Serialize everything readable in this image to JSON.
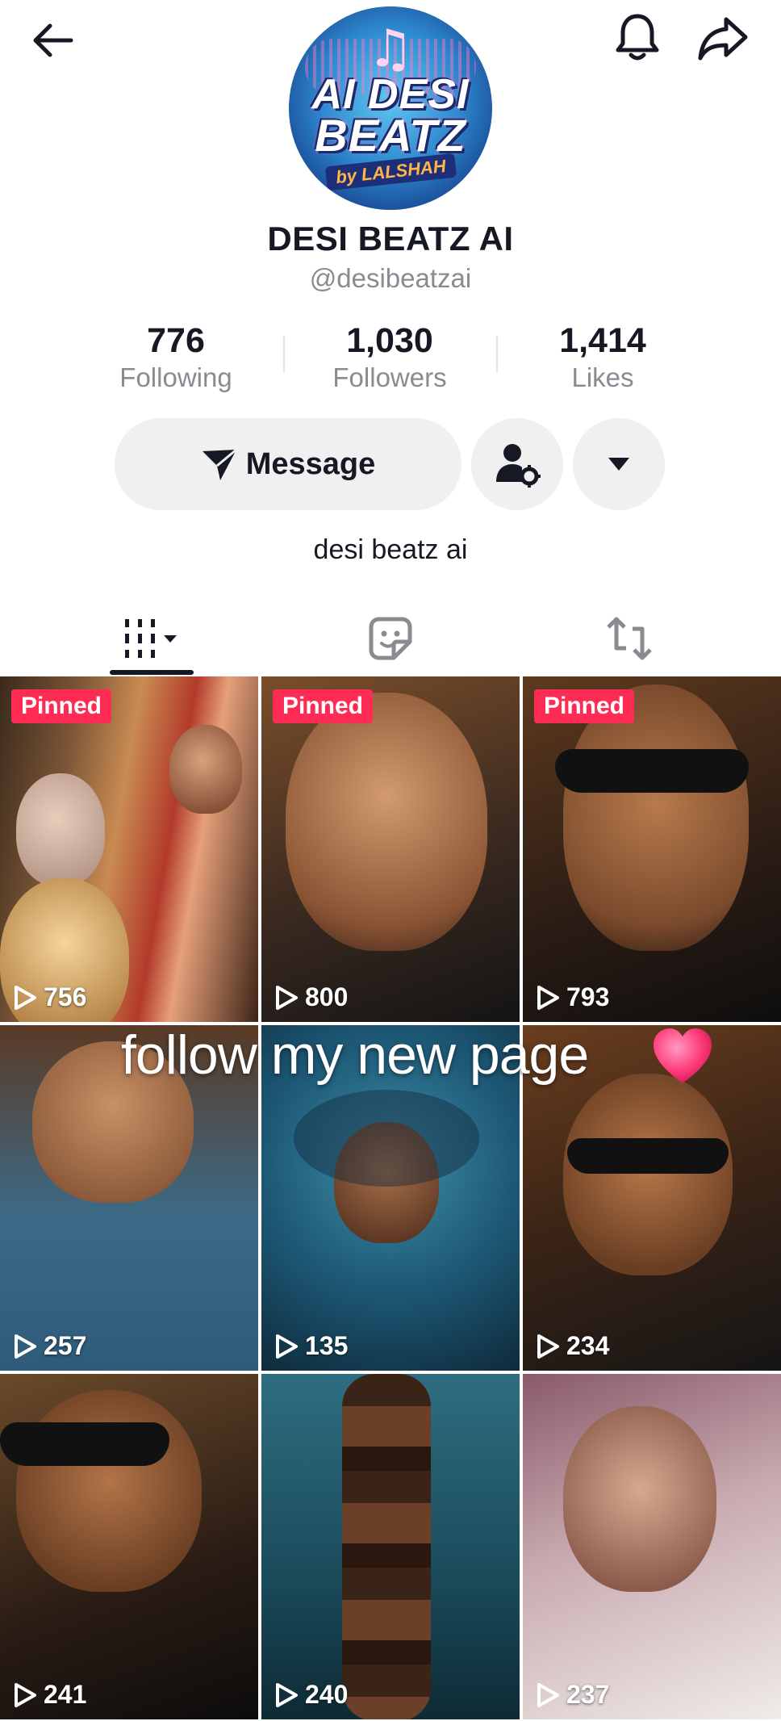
{
  "profile": {
    "name": "DESI BEATZ AI",
    "handle": "@desibeatzai",
    "bio": "desi beatz ai",
    "avatar_logo": {
      "line1": "AI DESI",
      "line2": "BEATZ",
      "by": "by LALSHAH"
    }
  },
  "stats": [
    {
      "value": "776",
      "label": "Following"
    },
    {
      "value": "1,030",
      "label": "Followers"
    },
    {
      "value": "1,414",
      "label": "Likes"
    }
  ],
  "actions": {
    "message_label": "Message"
  },
  "tabs": [
    {
      "icon": "videos-grid-icon",
      "active": true
    },
    {
      "icon": "liked-sticker-icon",
      "active": false
    },
    {
      "icon": "repost-icon",
      "active": false
    }
  ],
  "videos": [
    {
      "views": "756",
      "pinned": true,
      "pinned_label": "Pinned"
    },
    {
      "views": "800",
      "pinned": true,
      "pinned_label": "Pinned"
    },
    {
      "views": "793",
      "pinned": true,
      "pinned_label": "Pinned"
    },
    {
      "views": "257",
      "pinned": false
    },
    {
      "views": "135",
      "pinned": false
    },
    {
      "views": "234",
      "pinned": false
    },
    {
      "views": "241",
      "pinned": false
    },
    {
      "views": "240",
      "pinned": false
    },
    {
      "views": "237",
      "pinned": false
    }
  ],
  "overlay_text": "follow my new page",
  "colors": {
    "accent": "#fe2c55",
    "text": "#161823",
    "secondary": "#8a8b91",
    "button_bg": "#f0f0f1"
  }
}
